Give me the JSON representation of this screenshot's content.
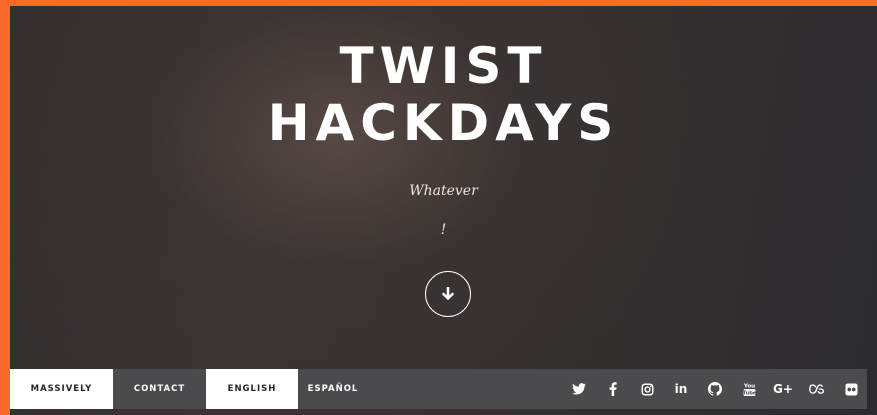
{
  "hero": {
    "title_line1": "TWIST",
    "title_line2": "HACKDAYS",
    "subtitle": "Whatever",
    "subtitle_mark": "!"
  },
  "nav": {
    "items": [
      {
        "label": "MASSIVELY",
        "active": true
      },
      {
        "label": "CONTACT",
        "active": false
      },
      {
        "label": "ENGLISH",
        "active": true
      },
      {
        "label": "ESPAÑOL",
        "active": false
      }
    ]
  },
  "social": {
    "icons": [
      "twitter-icon",
      "facebook-icon",
      "instagram-icon",
      "linkedin-icon",
      "github-icon",
      "youtube-icon",
      "google-plus-icon",
      "lastfm-icon",
      "flickr-icon"
    ],
    "linkedin_text": "in",
    "googleplus_text": "G+"
  },
  "colors": {
    "frame": "#fa6a2a",
    "nav_bg": "#4b4b4f",
    "nav_active_bg": "#ffffff",
    "nav_active_text": "#1e252d",
    "text": "#ffffff"
  }
}
